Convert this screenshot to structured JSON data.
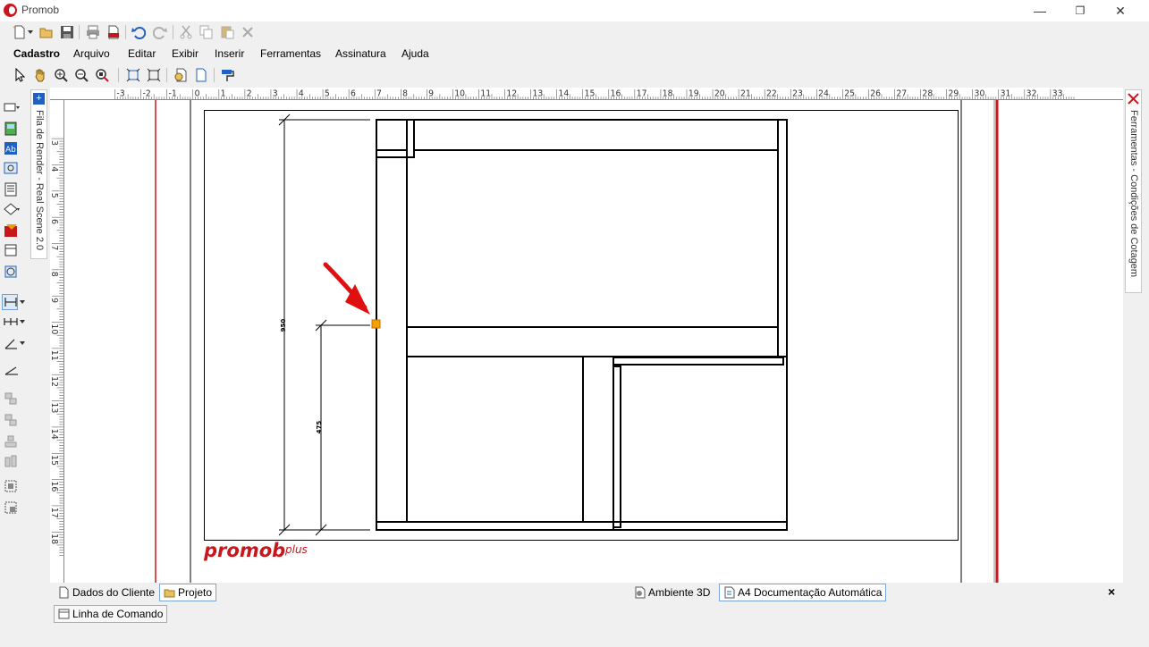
{
  "window": {
    "title": "Promob"
  },
  "menu": [
    "Cadastro",
    "Arquivo",
    "Editar",
    "Exibir",
    "Inserir",
    "Ferramentas",
    "Assinatura",
    "Ajuda"
  ],
  "side_panels": {
    "left": "Fila de Render - Real Scene 2.0",
    "right": "Ferramentas - Condições de Cotagem"
  },
  "ruler": {
    "horizontal": [
      "-3",
      "-2",
      "-1",
      "0",
      "1",
      "2",
      "3",
      "4",
      "5",
      "6",
      "7",
      "8",
      "9",
      "10",
      "11",
      "12",
      "13",
      "14",
      "15",
      "16",
      "17",
      "18",
      "19",
      "20",
      "21",
      "22",
      "23",
      "24",
      "25",
      "26",
      "27",
      "28",
      "29",
      "30",
      "31",
      "32",
      "33"
    ],
    "vertical": [
      "3",
      "4",
      "5",
      "6",
      "7",
      "8",
      "9",
      "10",
      "11",
      "12",
      "13",
      "14",
      "15",
      "16",
      "17",
      "18"
    ]
  },
  "drawing": {
    "dimension_total": "950",
    "dimension_partial": "475",
    "logo_main": "promob",
    "logo_sub": "plus"
  },
  "bottom_tabs": {
    "left": [
      "Dados do Cliente",
      "Projeto"
    ],
    "right": [
      "Ambiente 3D",
      "A4 Documentação Automática"
    ],
    "close": "×"
  },
  "command_line": "Linha de Comando",
  "colors": {
    "accent_red": "#c8161d",
    "marker_orange": "#f5a000",
    "arrow_red": "#e01010"
  }
}
